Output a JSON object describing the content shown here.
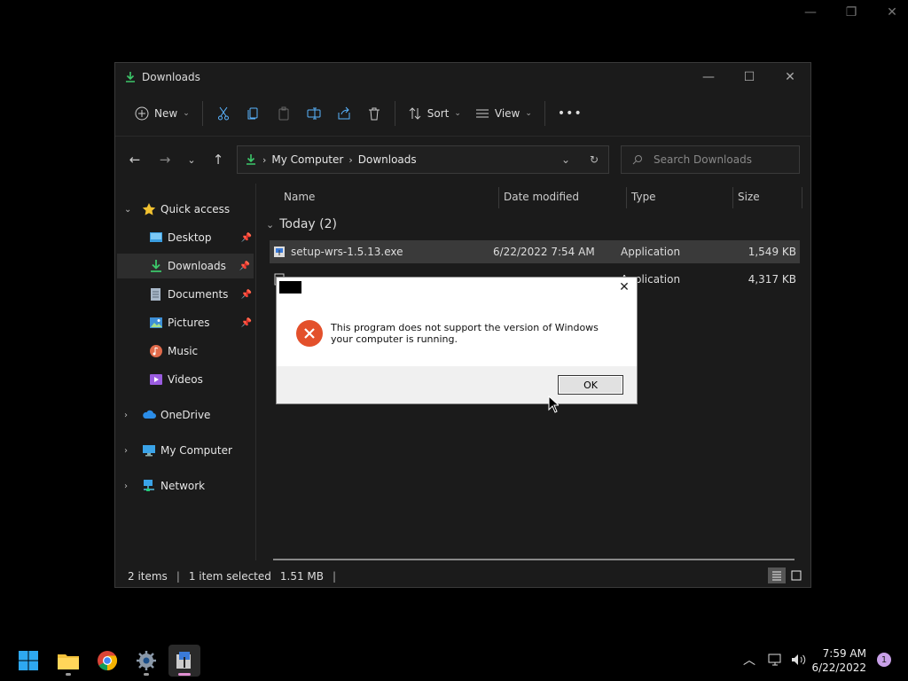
{
  "explorer": {
    "title": "Downloads",
    "toolbar": {
      "new_label": "New",
      "sort_label": "Sort",
      "view_label": "View",
      "more_label": "•••"
    },
    "address": {
      "crumbs": [
        "My Computer",
        "Downloads"
      ]
    },
    "search": {
      "placeholder": "Search Downloads"
    },
    "sidebar": {
      "quick_access": "Quick access",
      "items": [
        {
          "label": "Desktop",
          "icon": "desktop-icon",
          "pinned": true
        },
        {
          "label": "Downloads",
          "icon": "download-icon",
          "pinned": true,
          "selected": true
        },
        {
          "label": "Documents",
          "icon": "documents-icon",
          "pinned": true
        },
        {
          "label": "Pictures",
          "icon": "pictures-icon",
          "pinned": true
        },
        {
          "label": "Music",
          "icon": "music-icon",
          "pinned": false
        },
        {
          "label": "Videos",
          "icon": "videos-icon",
          "pinned": false
        }
      ],
      "onedrive": "OneDrive",
      "my_computer": "My Computer",
      "network": "Network"
    },
    "columns": {
      "name": "Name",
      "date": "Date modified",
      "type": "Type",
      "size": "Size"
    },
    "group": "Today (2)",
    "files": [
      {
        "name": "setup-wrs-1.5.13.exe",
        "date": "6/22/2022 7:54 AM",
        "type": "Application",
        "size": "1,549 KB",
        "selected": true
      },
      {
        "name": "",
        "date": "",
        "type": "Application",
        "size": "4,317 KB",
        "selected": false
      }
    ],
    "status": {
      "items": "2 items",
      "selected": "1 item selected",
      "size": "1.51 MB"
    }
  },
  "dialog": {
    "message": "This program does not support the version of Windows your computer is running.",
    "ok_label": "OK",
    "close_label": "✕"
  },
  "taskbar": {
    "time": "7:59 AM",
    "date": "6/22/2022",
    "notification_count": "1"
  },
  "colors": {
    "accent_green": "#3cc86a",
    "error_red": "#e3502b",
    "folder_blue": "#4aa3e8"
  }
}
